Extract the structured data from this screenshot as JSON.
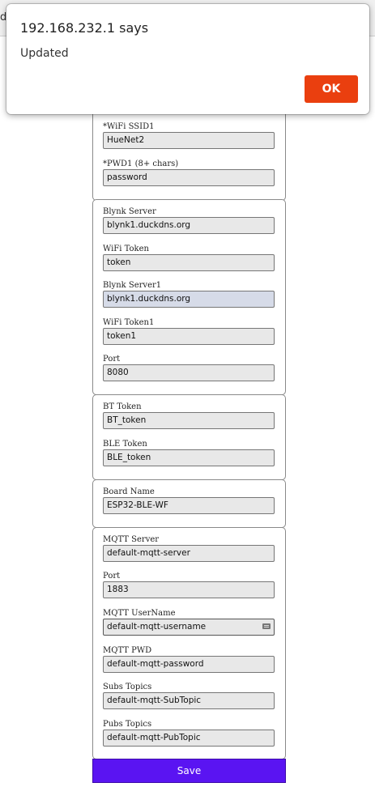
{
  "browser": {
    "tab_fragment": "du"
  },
  "dialog": {
    "title": "192.168.232.1 says",
    "message": "Updated",
    "ok_label": "OK"
  },
  "wifi": {
    "ssid1_label": "*WiFi SSID1",
    "ssid1_value": "HueNet2",
    "pwd1_label": "*PWD1 (8+ chars)",
    "pwd1_value": "password"
  },
  "blynk": {
    "server_label": "Blynk Server",
    "server_value": "blynk1.duckdns.org",
    "wifi_token_label": "WiFi Token",
    "wifi_token_value": "token",
    "server1_label": "Blynk Server1",
    "server1_value": "blynk1.duckdns.org",
    "wifi_token1_label": "WiFi Token1",
    "wifi_token1_value": "token1",
    "port_label": "Port",
    "port_value": "8080"
  },
  "bt": {
    "bt_token_label": "BT Token",
    "bt_token_value": "BT_token",
    "ble_token_label": "BLE Token",
    "ble_token_value": "BLE_token"
  },
  "board": {
    "name_label": "Board Name",
    "name_value": "ESP32-BLE-WF"
  },
  "mqtt": {
    "server_label": "MQTT Server",
    "server_value": "default-mqtt-server",
    "port_label": "Port",
    "port_value": "1883",
    "username_label": "MQTT UserName",
    "username_value": "default-mqtt-username",
    "pwd_label": "MQTT PWD",
    "pwd_value": "default-mqtt-password",
    "subs_label": "Subs Topics",
    "subs_value": "default-mqtt-SubTopic",
    "pubs_label": "Pubs Topics",
    "pubs_value": "default-mqtt-PubTopic"
  },
  "save_label": "Save",
  "colors": {
    "save_button": "#5a14f2",
    "ok_button": "#ea3f0f",
    "autofill_input": "#d6dbe8"
  }
}
